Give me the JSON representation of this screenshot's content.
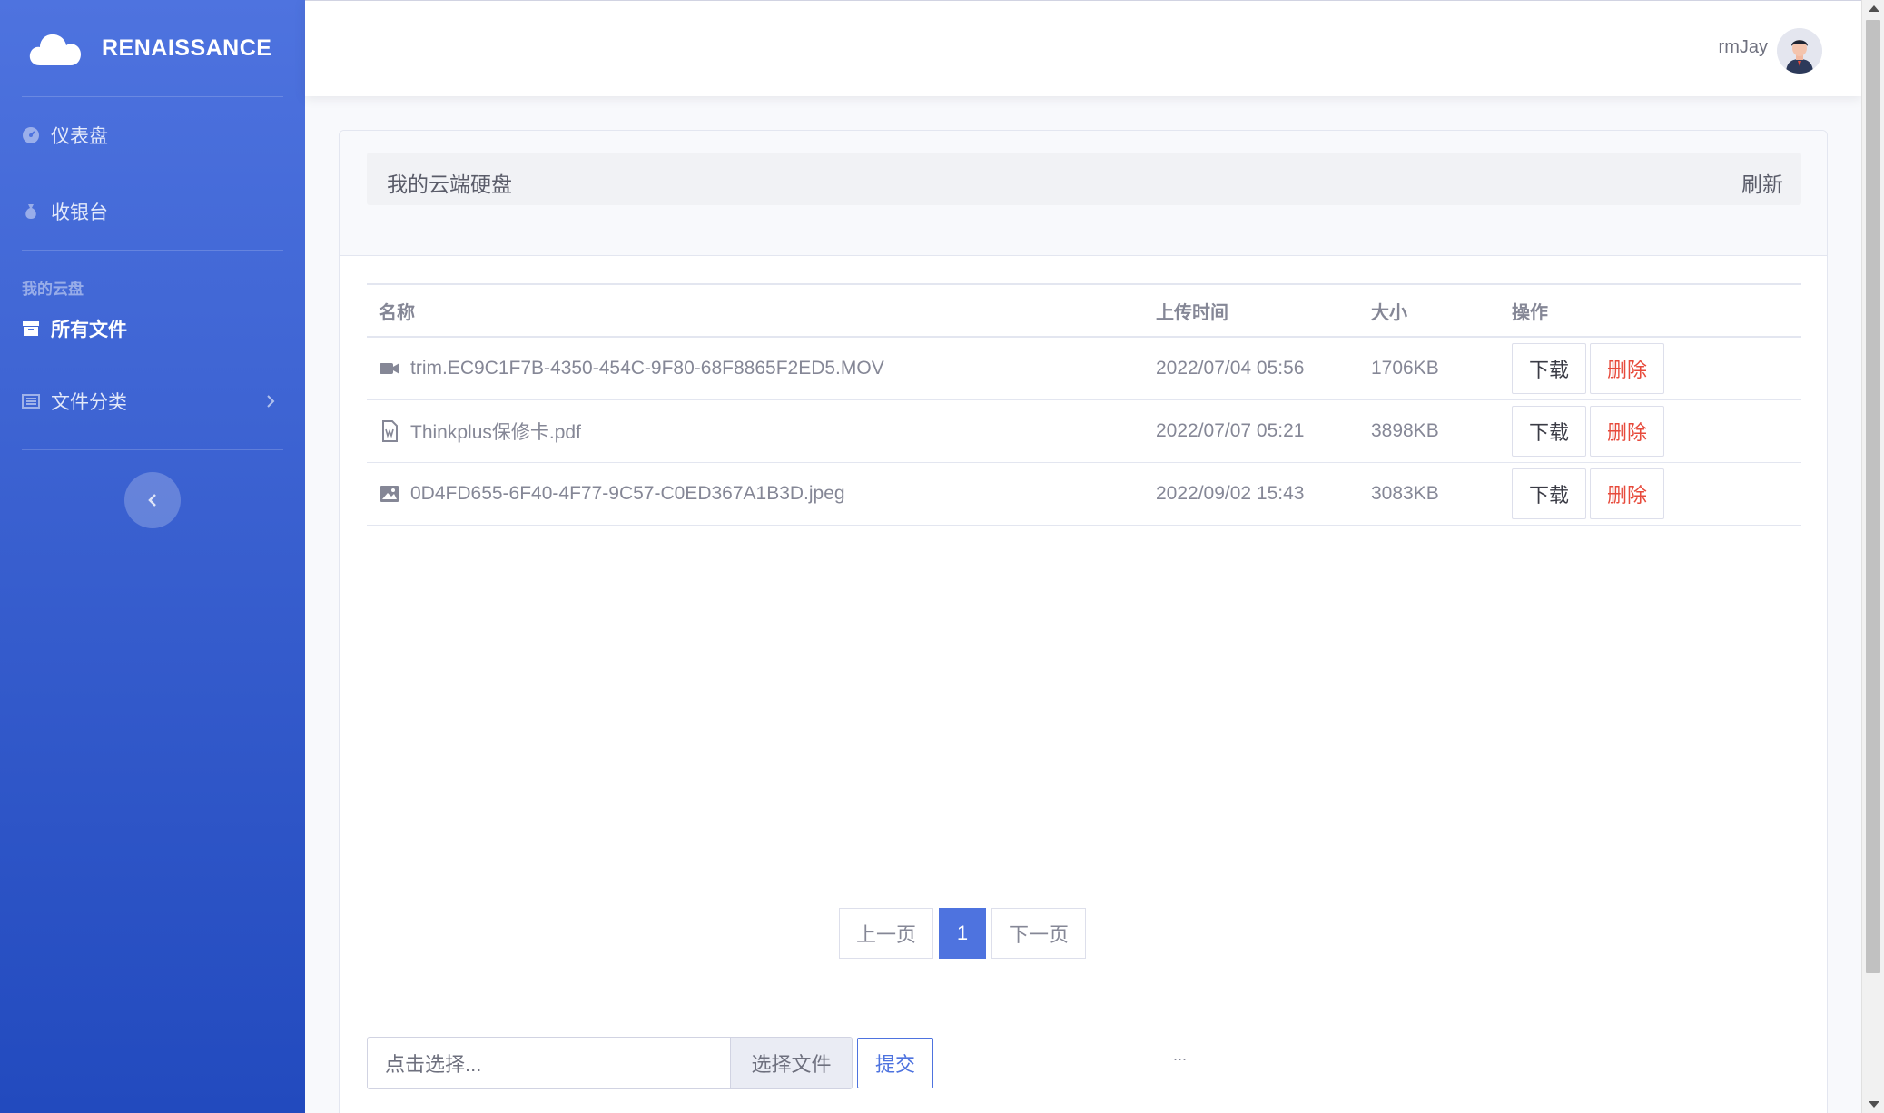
{
  "brand": {
    "name": "RENAISSANCE"
  },
  "sidebar": {
    "items": [
      {
        "label": "仪表盘",
        "icon": "dashboard-icon"
      },
      {
        "label": "收银台",
        "icon": "money-bag-icon"
      }
    ],
    "section_heading": "我的云盘",
    "section_items": [
      {
        "label": "所有文件",
        "icon": "archive-icon",
        "active": true
      },
      {
        "label": "文件分类",
        "icon": "list-icon",
        "has_submenu": true
      }
    ]
  },
  "topbar": {
    "user_name": "rmJay"
  },
  "card": {
    "title": "我的云端硬盘",
    "refresh_label": "刷新"
  },
  "table": {
    "headers": {
      "name": "名称",
      "time": "上传时间",
      "size": "大小",
      "actions": "操作"
    },
    "rows": [
      {
        "icon": "video-icon",
        "name": "trim.EC9C1F7B-4350-454C-9F80-68F8865F2ED5.MOV",
        "time": "2022/07/04 05:56",
        "size": "1706KB",
        "download": "下载",
        "delete": "删除"
      },
      {
        "icon": "word-file-icon",
        "name": "Thinkplus保修卡.pdf",
        "time": "2022/07/07 05:21",
        "size": "3898KB",
        "download": "下载",
        "delete": "删除"
      },
      {
        "icon": "image-icon",
        "name": "0D4FD655-6F40-4F77-9C57-C0ED367A1B3D.jpeg",
        "time": "2022/09/02 15:43",
        "size": "3083KB",
        "download": "下载",
        "delete": "删除"
      }
    ]
  },
  "pagination": {
    "prev": "上一页",
    "current": "1",
    "next": "下一页"
  },
  "upload": {
    "placeholder": "点击选择...",
    "choose_label": "选择文件",
    "submit_label": "提交",
    "status": "..."
  },
  "colors": {
    "primary": "#4e73df",
    "danger": "#e74a3b",
    "sidebar_gradient_top": "#4e73df",
    "sidebar_gradient_bottom": "#224abe"
  }
}
